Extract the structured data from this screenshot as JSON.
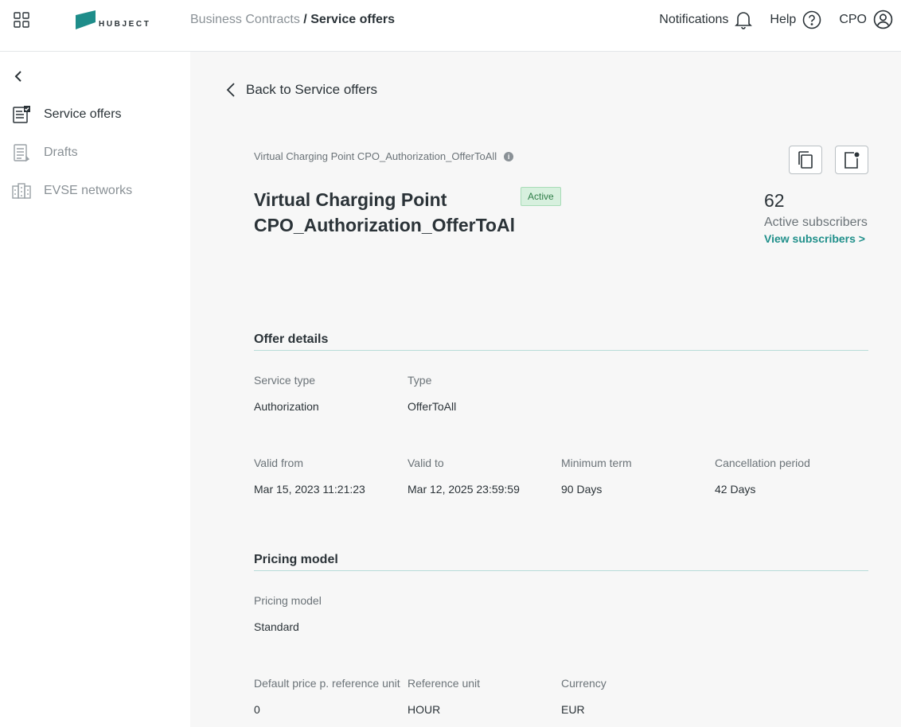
{
  "header": {
    "logo_text": "HUBJECT",
    "breadcrumb": {
      "parent": "Business Contracts",
      "separator": "/",
      "current": "Service offers"
    },
    "nav": {
      "notifications": "Notifications",
      "help": "Help",
      "user": "CPO"
    }
  },
  "sidebar": {
    "items": [
      {
        "label": "Service offers",
        "icon": "service-offers-icon"
      },
      {
        "label": "Drafts",
        "icon": "drafts-icon"
      },
      {
        "label": "EVSE networks",
        "icon": "evse-networks-icon"
      }
    ]
  },
  "main": {
    "back_label": "Back to Service offers",
    "subtitle": "Virtual Charging Point CPO_Authorization_OfferToAll",
    "info_glyph": "i",
    "title": "Virtual Charging Point CPO_Authorization_OfferToAl",
    "status": "Active",
    "subscribers": {
      "count": "62",
      "label": "Active subscribers",
      "link": "View subscribers >"
    },
    "offer_details": {
      "title": "Offer details",
      "fields": [
        {
          "label": "Service type",
          "value": "Authorization"
        },
        {
          "label": "Type",
          "value": "OfferToAll"
        },
        {
          "label": "Valid from",
          "value": "Mar 15, 2023 11:21:23"
        },
        {
          "label": "Valid to",
          "value": "Mar 12, 2025 23:59:59"
        },
        {
          "label": "Minimum term",
          "value": "90 Days"
        },
        {
          "label": "Cancellation period",
          "value": "42 Days"
        }
      ]
    },
    "pricing": {
      "title": "Pricing model",
      "fields": [
        {
          "label": "Pricing model",
          "value": "Standard"
        },
        {
          "label": "Default price p. reference unit",
          "value": "0"
        },
        {
          "label": "Reference unit",
          "value": "HOUR"
        },
        {
          "label": "Currency",
          "value": "EUR"
        }
      ]
    }
  },
  "colors": {
    "accent": "#1f8f8a",
    "logo": "#1e8d8a",
    "badge_bg": "#d7f0de",
    "badge_text": "#2f7d48"
  }
}
